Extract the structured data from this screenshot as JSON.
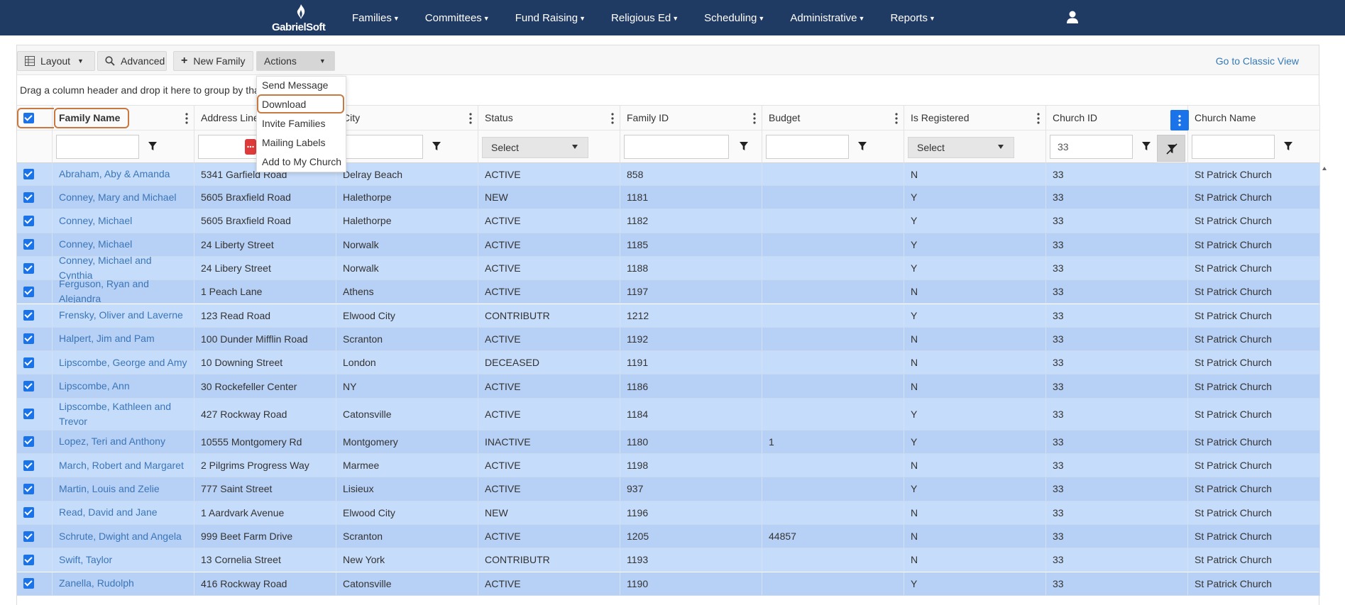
{
  "brand": {
    "logo_text": "GabrielSoft"
  },
  "nav": {
    "items": [
      {
        "label": "Families"
      },
      {
        "label": "Committees"
      },
      {
        "label": "Fund Raising"
      },
      {
        "label": "Religious Ed"
      },
      {
        "label": "Scheduling"
      },
      {
        "label": "Administrative"
      },
      {
        "label": "Reports"
      }
    ],
    "user_icon": "user-icon"
  },
  "toolbar": {
    "layout_label": "Layout",
    "advanced_label": "Advanced",
    "new_family_label": "New Family",
    "actions_label": "Actions",
    "classic_link": "Go to Classic View"
  },
  "actions_menu": {
    "items": [
      {
        "label": "Send Message"
      },
      {
        "label": "Download"
      },
      {
        "label": "Invite Families"
      },
      {
        "label": "Mailing Labels"
      },
      {
        "label": "Add to My Church"
      }
    ],
    "highlighted": "Download"
  },
  "group_hint": "Drag a column header and drop it here to group by that column",
  "columns": [
    {
      "label": "Family Name"
    },
    {
      "label": "Address Line 1"
    },
    {
      "label": "City"
    },
    {
      "label": "Status"
    },
    {
      "label": "Family ID"
    },
    {
      "label": "Budget"
    },
    {
      "label": "Is Registered"
    },
    {
      "label": "Church ID"
    },
    {
      "label": "Church Name"
    }
  ],
  "filters": {
    "status_select": "Select",
    "registered_select": "Select",
    "church_id_value": "33"
  },
  "rows": [
    {
      "name": "Abraham, Aby & Amanda",
      "address": "5341 Garfield Road",
      "city": "Delray Beach",
      "status": "ACTIVE",
      "family_id": "858",
      "budget": "",
      "registered": "N",
      "church_id": "33",
      "church": "St Patrick Church"
    },
    {
      "name": "Conney, Mary and Michael",
      "address": "5605 Braxfield Road",
      "city": "Halethorpe",
      "status": "NEW",
      "family_id": "1181",
      "budget": "",
      "registered": "Y",
      "church_id": "33",
      "church": "St Patrick Church"
    },
    {
      "name": "Conney, Michael",
      "address": "5605 Braxfield Road",
      "city": "Halethorpe",
      "status": "ACTIVE",
      "family_id": "1182",
      "budget": "",
      "registered": "Y",
      "church_id": "33",
      "church": "St Patrick Church"
    },
    {
      "name": "Conney, Michael",
      "address": "24 Liberty Street",
      "city": "Norwalk",
      "status": "ACTIVE",
      "family_id": "1185",
      "budget": "",
      "registered": "Y",
      "church_id": "33",
      "church": "St Patrick Church"
    },
    {
      "name": "Conney, Michael and Cynthia",
      "address": "24 Libery Street",
      "city": "Norwalk",
      "status": "ACTIVE",
      "family_id": "1188",
      "budget": "",
      "registered": "Y",
      "church_id": "33",
      "church": "St Patrick Church"
    },
    {
      "name": "Ferguson, Ryan and Alejandra",
      "address": "1 Peach Lane",
      "city": "Athens",
      "status": "ACTIVE",
      "family_id": "1197",
      "budget": "",
      "registered": "N",
      "church_id": "33",
      "church": "St Patrick Church"
    },
    {
      "name": "Frensky, Oliver and Laverne",
      "address": "123 Read Road",
      "city": "Elwood City",
      "status": "CONTRIBUTR",
      "family_id": "1212",
      "budget": "",
      "registered": "Y",
      "church_id": "33",
      "church": "St Patrick Church"
    },
    {
      "name": "Halpert, Jim and Pam",
      "address": "100 Dunder Mifflin Road",
      "city": "Scranton",
      "status": "ACTIVE",
      "family_id": "1192",
      "budget": "",
      "registered": "N",
      "church_id": "33",
      "church": "St Patrick Church"
    },
    {
      "name": "Lipscombe, George and Amy",
      "address": "10 Downing Street",
      "city": "London",
      "status": "DECEASED",
      "family_id": "1191",
      "budget": "",
      "registered": "N",
      "church_id": "33",
      "church": "St Patrick Church"
    },
    {
      "name": "Lipscombe, Ann",
      "address": "30 Rockefeller Center",
      "city": "NY",
      "status": "ACTIVE",
      "family_id": "1186",
      "budget": "",
      "registered": "N",
      "church_id": "33",
      "church": "St Patrick Church"
    },
    {
      "name": "Lipscombe, Kathleen and Trevor",
      "address": "427 Rockway Road",
      "city": "Catonsville",
      "status": "ACTIVE",
      "family_id": "1184",
      "budget": "",
      "registered": "Y",
      "church_id": "33",
      "church": "St Patrick Church"
    },
    {
      "name": "Lopez, Teri and Anthony",
      "address": "10555 Montgomery Rd",
      "city": "Montgomery",
      "status": "INACTIVE",
      "family_id": "1180",
      "budget": "1",
      "registered": "Y",
      "church_id": "33",
      "church": "St Patrick Church"
    },
    {
      "name": "March, Robert and Margaret",
      "address": "2 Pilgrims Progress Way",
      "city": "Marmee",
      "status": "ACTIVE",
      "family_id": "1198",
      "budget": "",
      "registered": "N",
      "church_id": "33",
      "church": "St Patrick Church"
    },
    {
      "name": "Martin, Louis and Zelie",
      "address": "777 Saint Street",
      "city": "Lisieux",
      "status": "ACTIVE",
      "family_id": "937",
      "budget": "",
      "registered": "Y",
      "church_id": "33",
      "church": "St Patrick Church"
    },
    {
      "name": "Read, David and Jane",
      "address": "1 Aardvark Avenue",
      "city": "Elwood City",
      "status": "NEW",
      "family_id": "1196",
      "budget": "",
      "registered": "N",
      "church_id": "33",
      "church": "St Patrick Church"
    },
    {
      "name": "Schrute, Dwight and Angela",
      "address": "999 Beet Farm Drive",
      "city": "Scranton",
      "status": "ACTIVE",
      "family_id": "1205",
      "budget": "44857",
      "registered": "N",
      "church_id": "33",
      "church": "St Patrick Church"
    },
    {
      "name": "Swift, Taylor",
      "address": "13 Cornelia Street",
      "city": "New York",
      "status": "CONTRIBUTR",
      "family_id": "1193",
      "budget": "",
      "registered": "N",
      "church_id": "33",
      "church": "St Patrick Church"
    },
    {
      "name": "Zanella, Rudolph",
      "address": "416 Rockway Road",
      "city": "Catonsville",
      "status": "ACTIVE",
      "family_id": "1190",
      "budget": "",
      "registered": "Y",
      "church_id": "33",
      "church": "St Patrick Church"
    }
  ],
  "colors": {
    "nav_bg": "#1f3a63",
    "row_a": "#c6dcfb",
    "row_b": "#b7d0f5",
    "link": "#3b76b8",
    "accent": "#1a73e8",
    "highlight": "#c87941"
  }
}
